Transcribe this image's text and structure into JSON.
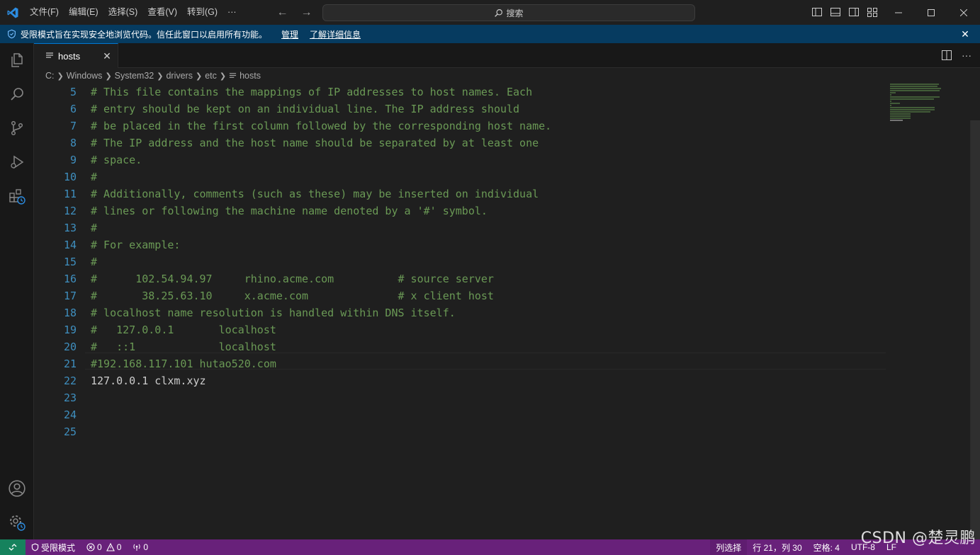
{
  "titlebar": {
    "menu": [
      {
        "label": "文件(F)"
      },
      {
        "label": "编辑(E)"
      },
      {
        "label": "选择(S)"
      },
      {
        "label": "查看(V)"
      },
      {
        "label": "转到(G)"
      },
      {
        "label": "···"
      }
    ],
    "search_placeholder": "搜索"
  },
  "banner": {
    "text": "受限模式旨在实现安全地浏览代码。信任此窗口以启用所有功能。",
    "manage_link": "管理",
    "learn_more_link": "了解详细信息"
  },
  "tab": {
    "label": "hosts"
  },
  "breadcrumb": [
    "C:",
    "Windows",
    "System32",
    "drivers",
    "etc",
    "hosts"
  ],
  "editor": {
    "lines": [
      {
        "num": "5",
        "text": "# This file contains the mappings of IP addresses to host names. Each",
        "kind": "comment"
      },
      {
        "num": "6",
        "text": "# entry should be kept on an individual line. The IP address should",
        "kind": "comment"
      },
      {
        "num": "7",
        "text": "# be placed in the first column followed by the corresponding host name.",
        "kind": "comment"
      },
      {
        "num": "8",
        "text": "# The IP address and the host name should be separated by at least one",
        "kind": "comment"
      },
      {
        "num": "9",
        "text": "# space.",
        "kind": "comment"
      },
      {
        "num": "10",
        "text": "#",
        "kind": "comment"
      },
      {
        "num": "11",
        "text": "# Additionally, comments (such as these) may be inserted on individual",
        "kind": "comment"
      },
      {
        "num": "12",
        "text": "# lines or following the machine name denoted by a '#' symbol.",
        "kind": "comment"
      },
      {
        "num": "13",
        "text": "#",
        "kind": "comment"
      },
      {
        "num": "14",
        "text": "# For example:",
        "kind": "comment"
      },
      {
        "num": "15",
        "text": "#",
        "kind": "comment"
      },
      {
        "num": "16",
        "text": "#      102.54.94.97     rhino.acme.com          # source server",
        "kind": "comment"
      },
      {
        "num": "17",
        "text": "#       38.25.63.10     x.acme.com              # x client host",
        "kind": "comment"
      },
      {
        "num": "18",
        "text": "# localhost name resolution is handled within DNS itself.",
        "kind": "comment"
      },
      {
        "num": "19",
        "text": "#   127.0.0.1       localhost",
        "kind": "comment"
      },
      {
        "num": "20",
        "text": "#   ::1             localhost",
        "kind": "comment"
      },
      {
        "num": "21",
        "text": "#192.168.117.101 hutao520.com",
        "kind": "comment"
      },
      {
        "num": "22",
        "text": "127.0.0.1 clxm.xyz",
        "kind": "plain"
      },
      {
        "num": "23",
        "text": "",
        "kind": "plain"
      },
      {
        "num": "24",
        "text": "",
        "kind": "plain"
      },
      {
        "num": "25",
        "text": "",
        "kind": "plain"
      }
    ]
  },
  "statusbar": {
    "restricted": "受限模式",
    "errors": "0",
    "warnings": "0",
    "ports": "0",
    "column_select": "列选择",
    "position": "行 21，列 30",
    "spaces": "空格: 4",
    "encoding": "UTF-8",
    "eol": "LF"
  },
  "watermark": "CSDN @楚灵鹏",
  "colors": {
    "accent": "#0078d4",
    "banner": "#063b60",
    "statusbar": "#68217a",
    "comment": "#6a9955"
  }
}
